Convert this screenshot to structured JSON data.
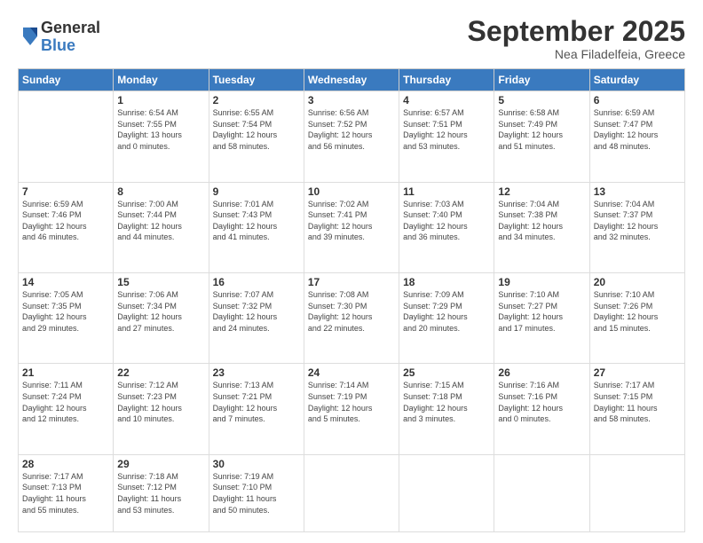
{
  "logo": {
    "general": "General",
    "blue": "Blue"
  },
  "header": {
    "month": "September 2025",
    "location": "Nea Filadelfeia, Greece"
  },
  "weekdays": [
    "Sunday",
    "Monday",
    "Tuesday",
    "Wednesday",
    "Thursday",
    "Friday",
    "Saturday"
  ],
  "weeks": [
    [
      {
        "day": "",
        "info": ""
      },
      {
        "day": "1",
        "info": "Sunrise: 6:54 AM\nSunset: 7:55 PM\nDaylight: 13 hours\nand 0 minutes."
      },
      {
        "day": "2",
        "info": "Sunrise: 6:55 AM\nSunset: 7:54 PM\nDaylight: 12 hours\nand 58 minutes."
      },
      {
        "day": "3",
        "info": "Sunrise: 6:56 AM\nSunset: 7:52 PM\nDaylight: 12 hours\nand 56 minutes."
      },
      {
        "day": "4",
        "info": "Sunrise: 6:57 AM\nSunset: 7:51 PM\nDaylight: 12 hours\nand 53 minutes."
      },
      {
        "day": "5",
        "info": "Sunrise: 6:58 AM\nSunset: 7:49 PM\nDaylight: 12 hours\nand 51 minutes."
      },
      {
        "day": "6",
        "info": "Sunrise: 6:59 AM\nSunset: 7:47 PM\nDaylight: 12 hours\nand 48 minutes."
      }
    ],
    [
      {
        "day": "7",
        "info": "Sunrise: 6:59 AM\nSunset: 7:46 PM\nDaylight: 12 hours\nand 46 minutes."
      },
      {
        "day": "8",
        "info": "Sunrise: 7:00 AM\nSunset: 7:44 PM\nDaylight: 12 hours\nand 44 minutes."
      },
      {
        "day": "9",
        "info": "Sunrise: 7:01 AM\nSunset: 7:43 PM\nDaylight: 12 hours\nand 41 minutes."
      },
      {
        "day": "10",
        "info": "Sunrise: 7:02 AM\nSunset: 7:41 PM\nDaylight: 12 hours\nand 39 minutes."
      },
      {
        "day": "11",
        "info": "Sunrise: 7:03 AM\nSunset: 7:40 PM\nDaylight: 12 hours\nand 36 minutes."
      },
      {
        "day": "12",
        "info": "Sunrise: 7:04 AM\nSunset: 7:38 PM\nDaylight: 12 hours\nand 34 minutes."
      },
      {
        "day": "13",
        "info": "Sunrise: 7:04 AM\nSunset: 7:37 PM\nDaylight: 12 hours\nand 32 minutes."
      }
    ],
    [
      {
        "day": "14",
        "info": "Sunrise: 7:05 AM\nSunset: 7:35 PM\nDaylight: 12 hours\nand 29 minutes."
      },
      {
        "day": "15",
        "info": "Sunrise: 7:06 AM\nSunset: 7:34 PM\nDaylight: 12 hours\nand 27 minutes."
      },
      {
        "day": "16",
        "info": "Sunrise: 7:07 AM\nSunset: 7:32 PM\nDaylight: 12 hours\nand 24 minutes."
      },
      {
        "day": "17",
        "info": "Sunrise: 7:08 AM\nSunset: 7:30 PM\nDaylight: 12 hours\nand 22 minutes."
      },
      {
        "day": "18",
        "info": "Sunrise: 7:09 AM\nSunset: 7:29 PM\nDaylight: 12 hours\nand 20 minutes."
      },
      {
        "day": "19",
        "info": "Sunrise: 7:10 AM\nSunset: 7:27 PM\nDaylight: 12 hours\nand 17 minutes."
      },
      {
        "day": "20",
        "info": "Sunrise: 7:10 AM\nSunset: 7:26 PM\nDaylight: 12 hours\nand 15 minutes."
      }
    ],
    [
      {
        "day": "21",
        "info": "Sunrise: 7:11 AM\nSunset: 7:24 PM\nDaylight: 12 hours\nand 12 minutes."
      },
      {
        "day": "22",
        "info": "Sunrise: 7:12 AM\nSunset: 7:23 PM\nDaylight: 12 hours\nand 10 minutes."
      },
      {
        "day": "23",
        "info": "Sunrise: 7:13 AM\nSunset: 7:21 PM\nDaylight: 12 hours\nand 7 minutes."
      },
      {
        "day": "24",
        "info": "Sunrise: 7:14 AM\nSunset: 7:19 PM\nDaylight: 12 hours\nand 5 minutes."
      },
      {
        "day": "25",
        "info": "Sunrise: 7:15 AM\nSunset: 7:18 PM\nDaylight: 12 hours\nand 3 minutes."
      },
      {
        "day": "26",
        "info": "Sunrise: 7:16 AM\nSunset: 7:16 PM\nDaylight: 12 hours\nand 0 minutes."
      },
      {
        "day": "27",
        "info": "Sunrise: 7:17 AM\nSunset: 7:15 PM\nDaylight: 11 hours\nand 58 minutes."
      }
    ],
    [
      {
        "day": "28",
        "info": "Sunrise: 7:17 AM\nSunset: 7:13 PM\nDaylight: 11 hours\nand 55 minutes."
      },
      {
        "day": "29",
        "info": "Sunrise: 7:18 AM\nSunset: 7:12 PM\nDaylight: 11 hours\nand 53 minutes."
      },
      {
        "day": "30",
        "info": "Sunrise: 7:19 AM\nSunset: 7:10 PM\nDaylight: 11 hours\nand 50 minutes."
      },
      {
        "day": "",
        "info": ""
      },
      {
        "day": "",
        "info": ""
      },
      {
        "day": "",
        "info": ""
      },
      {
        "day": "",
        "info": ""
      }
    ]
  ]
}
